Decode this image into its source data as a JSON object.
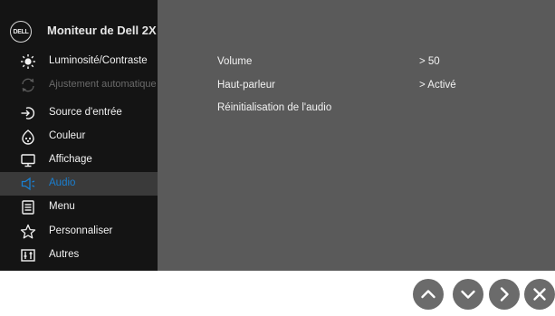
{
  "app": {
    "title": "Moniteur de Dell 2X",
    "logo_text": "DELL"
  },
  "menu": [
    {
      "label": "Luminosité/Contraste",
      "icon": "sun-icon",
      "state": "normal"
    },
    {
      "label": "Ajustement automatique",
      "icon": "auto-adjust-icon",
      "state": "disabled"
    },
    {
      "label": "Source d'entrée",
      "icon": "input-source-icon",
      "state": "normal"
    },
    {
      "label": "Couleur",
      "icon": "color-palette-icon",
      "state": "normal"
    },
    {
      "label": "Affichage",
      "icon": "monitor-icon",
      "state": "normal"
    },
    {
      "label": "Audio",
      "icon": "speaker-icon",
      "state": "active"
    },
    {
      "label": "Menu",
      "icon": "menu-list-icon",
      "state": "normal"
    },
    {
      "label": "Personnaliser",
      "icon": "star-icon",
      "state": "normal"
    },
    {
      "label": "Autres",
      "icon": "sliders-icon",
      "state": "normal"
    }
  ],
  "audio": {
    "volume_label": "Volume",
    "volume_value": "> 50",
    "speaker_label": "Haut-parleur",
    "speaker_value": "> Activé",
    "reset_label": "Réinitialisation de l'audio"
  },
  "buttons": [
    "up-arrow-icon",
    "down-arrow-icon",
    "right-arrow-icon",
    "close-icon"
  ],
  "colors": {
    "panel": "#5a5a5a",
    "sidebar": "#141414",
    "active_text": "#1a7fd0",
    "button": "#6b6b6b"
  }
}
